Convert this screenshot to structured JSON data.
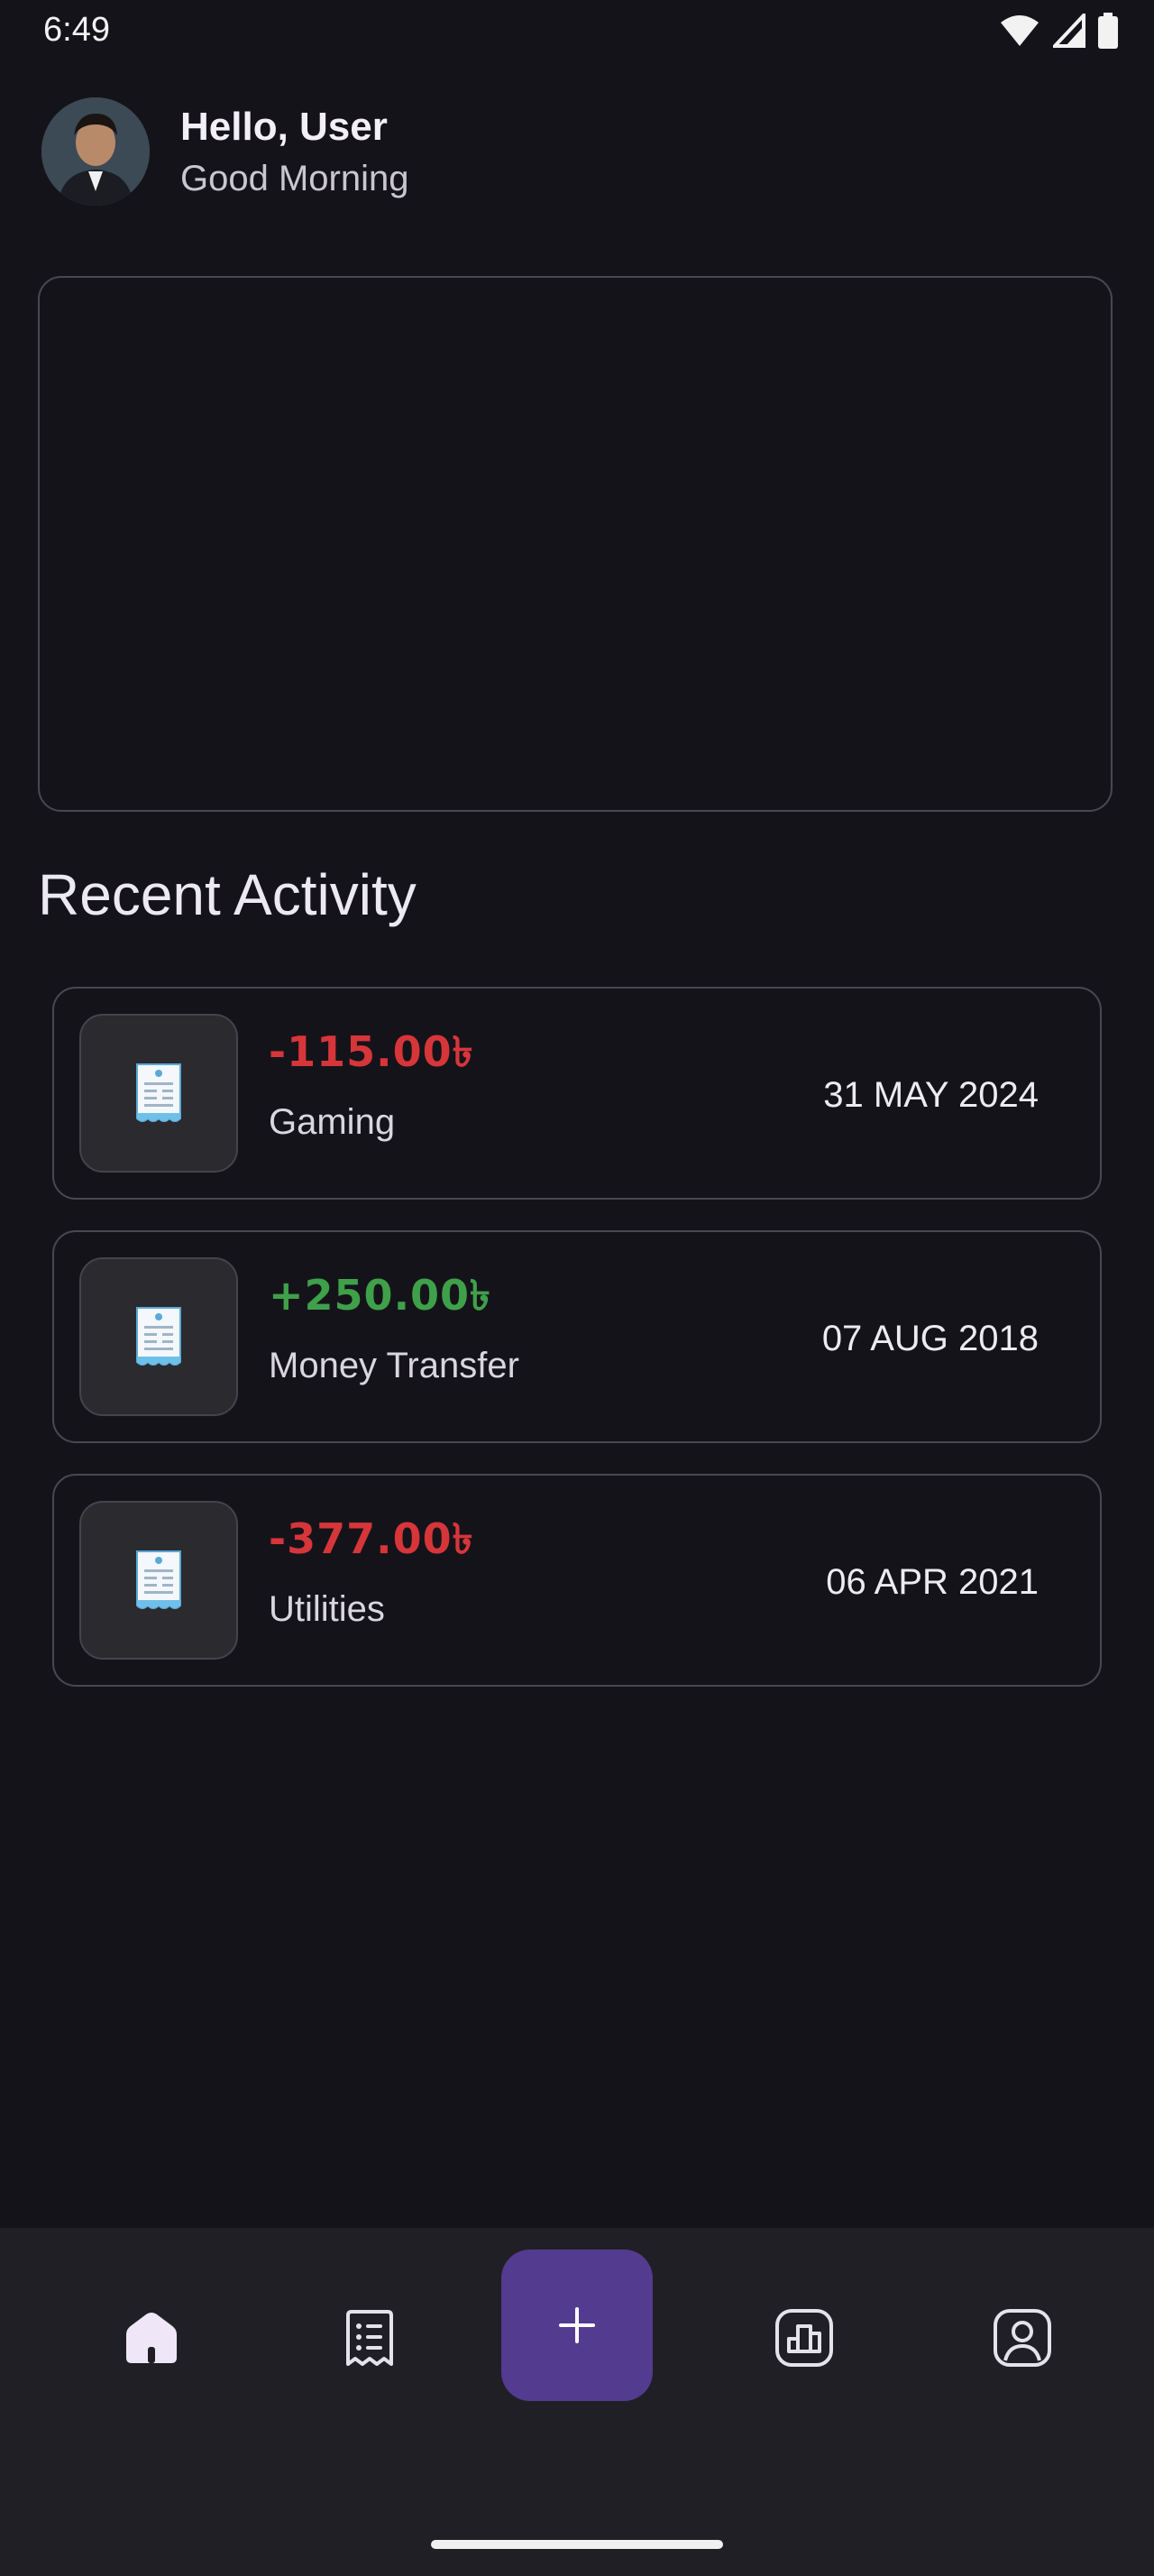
{
  "status_bar": {
    "time": "6:49"
  },
  "header": {
    "name": "Hello, User",
    "subtitle": "Good Morning"
  },
  "recent_activity_title": "Recent Activity",
  "transactions": [
    {
      "amount": "-115.00৳",
      "name": "Gaming",
      "date": "31 MAY 2024",
      "type": "expense"
    },
    {
      "amount": "+250.00৳",
      "name": "Money Transfer",
      "date": "07 AUG 2018",
      "type": "income"
    },
    {
      "amount": "-377.00৳",
      "name": "Utilities",
      "date": "06 APR 2021",
      "type": "expense"
    }
  ],
  "bottom_nav": {
    "items": [
      "home-icon",
      "receipt-list-icon",
      "plus-icon",
      "chart-icon",
      "profile-icon"
    ],
    "active": "home-icon"
  },
  "colors": {
    "background": "#15131a",
    "expense": "#d6363a",
    "income": "#3fa04a",
    "fab": "#533b8f"
  }
}
